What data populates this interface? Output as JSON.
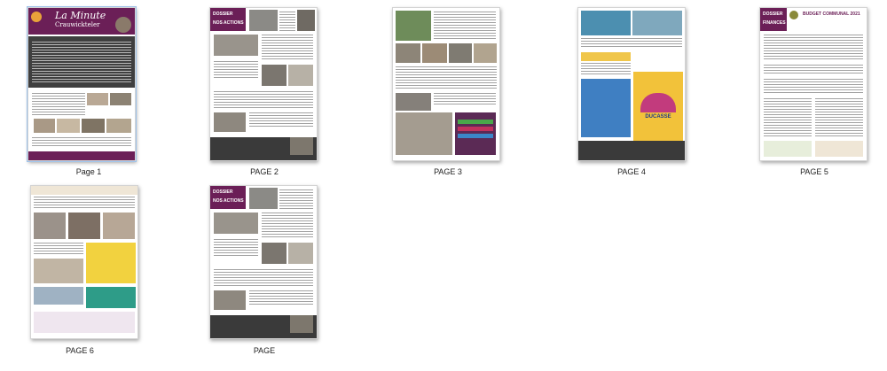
{
  "pages": [
    {
      "caption": "Page 1",
      "title": "La Minute",
      "subtitle": "Crauwickteler"
    },
    {
      "caption": "PAGE 2",
      "header_lines": [
        "DOSSIER",
        "NOS ACTIONS"
      ]
    },
    {
      "caption": "PAGE 3"
    },
    {
      "caption": "PAGE 4",
      "poster_word": "DUCASSE"
    },
    {
      "caption": "PAGE 5",
      "header_lines": [
        "DOSSIER",
        "FINANCES"
      ],
      "header_right": "BUDGET COMMUNAL 2021"
    },
    {
      "caption": "PAGE 6"
    },
    {
      "caption": "PAGE",
      "header_lines": [
        "DOSSIER",
        "NOS ACTIONS"
      ]
    }
  ],
  "colors": {
    "purple": "#6b1f57",
    "magenta": "#8a2a6e",
    "olive": "#8a8a3a",
    "cream": "#efe6d6",
    "dark": "#3a3a3a"
  }
}
